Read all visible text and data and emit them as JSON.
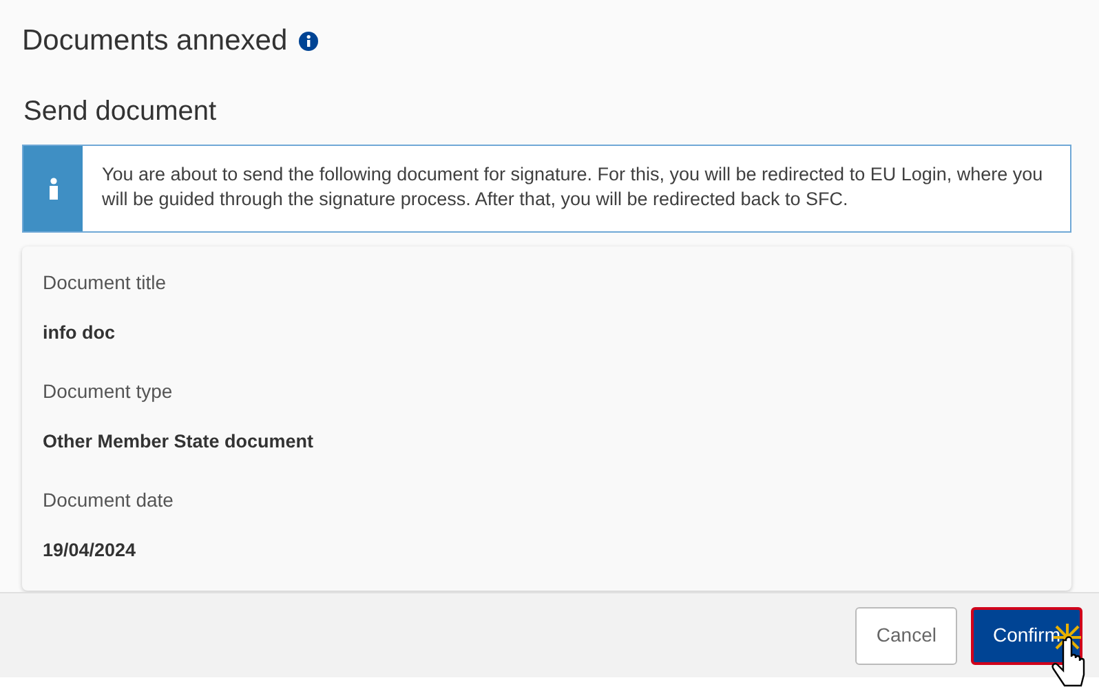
{
  "header": {
    "title": "Documents annexed"
  },
  "dialog": {
    "title": "Send document",
    "info": "You are about to send the following document for signature. For this, you will be redirected to EU Login, where you will be guided through the signature process. After that, you will be redirected back to SFC.",
    "fields": [
      {
        "label": "Document title",
        "value": "info doc"
      },
      {
        "label": "Document type",
        "value": "Other Member State document"
      },
      {
        "label": "Document date",
        "value": "19/04/2024"
      }
    ],
    "buttons": [
      {
        "label": "Cancel",
        "kind": "secondary",
        "highlighted": false
      },
      {
        "label": "Confirm",
        "kind": "primary",
        "highlighted": true
      }
    ]
  }
}
